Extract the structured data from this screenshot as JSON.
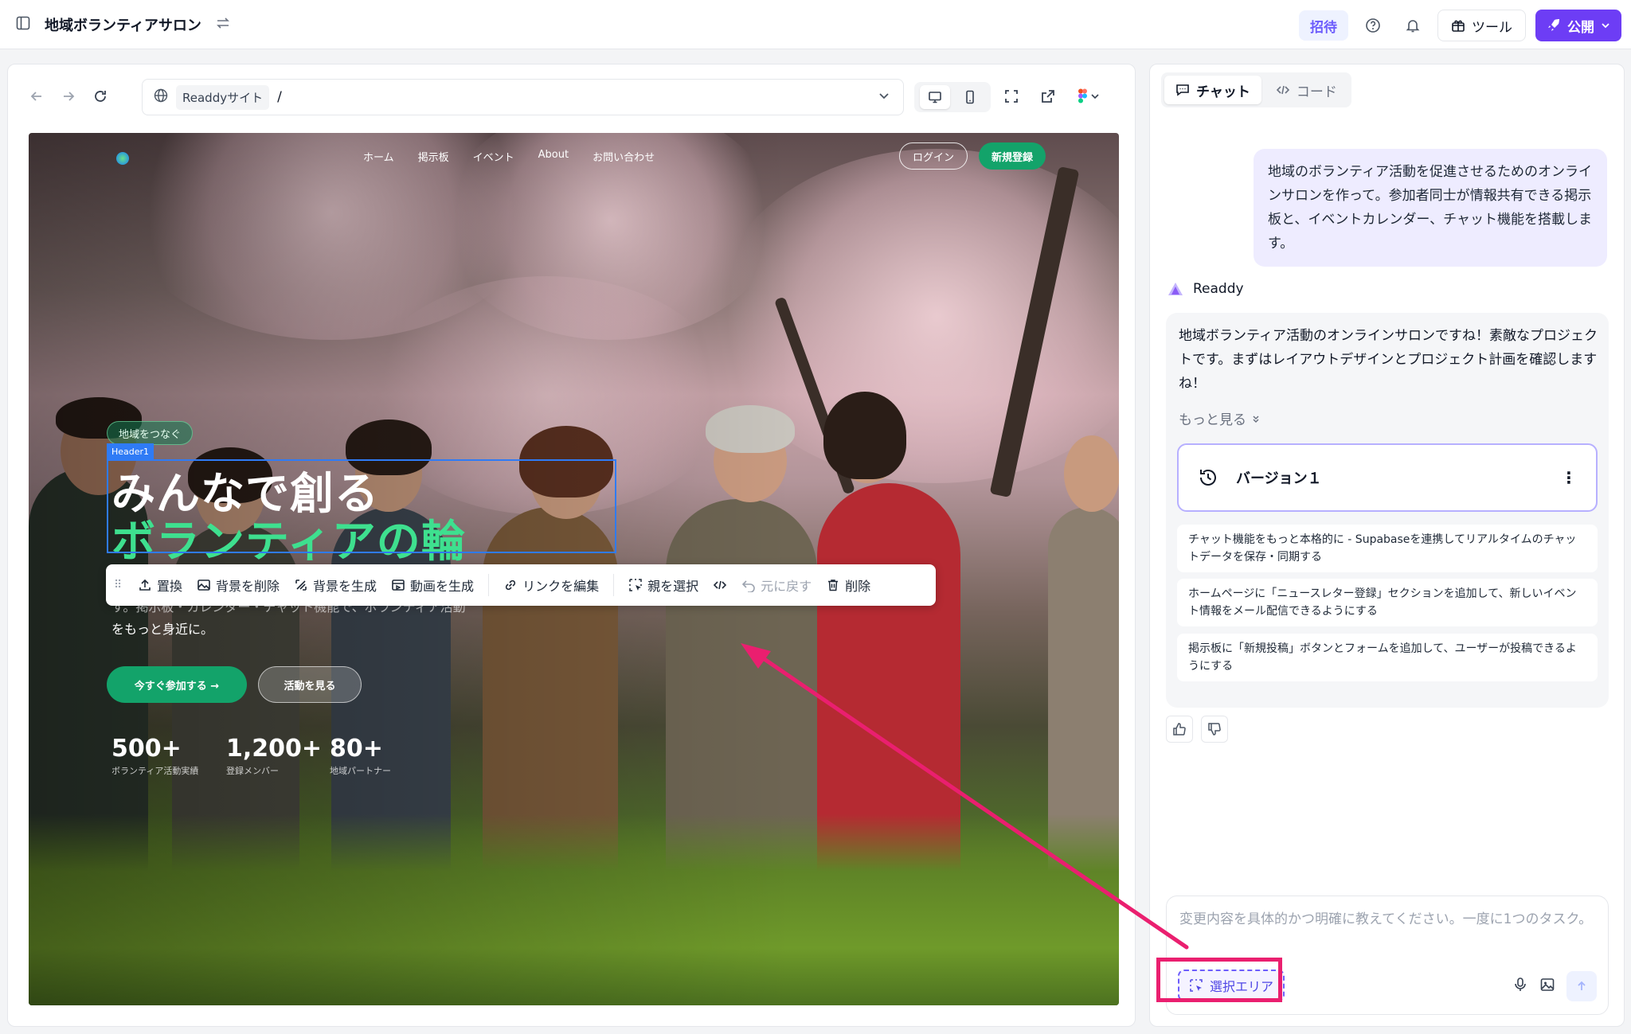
{
  "app": {
    "title": "地域ボランティアサロン",
    "invite_label": "招待",
    "tool_label": "ツール",
    "publish_label": "公開"
  },
  "browser": {
    "site_label": "Readdyサイト",
    "path": "/"
  },
  "site": {
    "nav": [
      "ホーム",
      "掲示板",
      "イベント",
      "About",
      "お問い合わせ"
    ],
    "login_label": "ログイン",
    "signup_label": "新規登録",
    "hero_badge": "地域をつなぐ",
    "selection_tag": "Header1",
    "hero_title_line1": "みんなで創る",
    "hero_title_line2": "ボランティアの輪",
    "hero_desc_line1": "す。掲示板・カレンダー・チャット機能で、ボランティア活動",
    "hero_desc_line2": "をもっと身近に。",
    "cta_primary": "今すぐ参加する →",
    "cta_secondary": "活動を見る",
    "stats": [
      {
        "value": "500+",
        "label": "ボランティア活動実績"
      },
      {
        "value": "1,200+",
        "label": "登録メンバー"
      },
      {
        "value": "80+",
        "label": "地域パートナー"
      }
    ]
  },
  "element_toolbar": {
    "items": [
      "置換",
      "背景を削除",
      "背景を生成",
      "動画を生成",
      "リンクを編集",
      "親を選択",
      "",
      "元に戻す",
      "削除"
    ]
  },
  "chat": {
    "tabs": [
      "チャット",
      "コード"
    ],
    "user_message": "地域のボランティア活動を促進させるためのオンラインサロンを作って。参加者同士が情報共有できる掲示板と、イベントカレンダー、チャット機能を搭載します。",
    "assistant_name": "Readdy",
    "assistant_message": "地域ボランティア活動のオンラインサロンですね！素敵なプロジェクトです。まずはレイアウトデザインとプロジェクト計画を確認しますね！",
    "more_label": "もっと見る",
    "version_label": "バージョン１",
    "suggestions": [
      "チャット機能をもっと本格的に - Supabaseを連携してリアルタイムのチャットデータを保存・同期する",
      "ホームページに「ニュースレター登録」セクションを追加して、新しいイベント情報をメール配信できるようにする",
      "掲示板に「新規投稿」ボタンとフォームを追加して、ユーザーが投稿できるようにする"
    ],
    "composer_placeholder": "変更内容を具体的かつ明確に教えてください。一度に1つのタスク。",
    "select_area_label": "選択エリア"
  },
  "colors": {
    "accent": "#6d3df5",
    "annotation": "#ea1f6f",
    "selection": "#2f7bf5",
    "site_green": "#13a36a"
  }
}
